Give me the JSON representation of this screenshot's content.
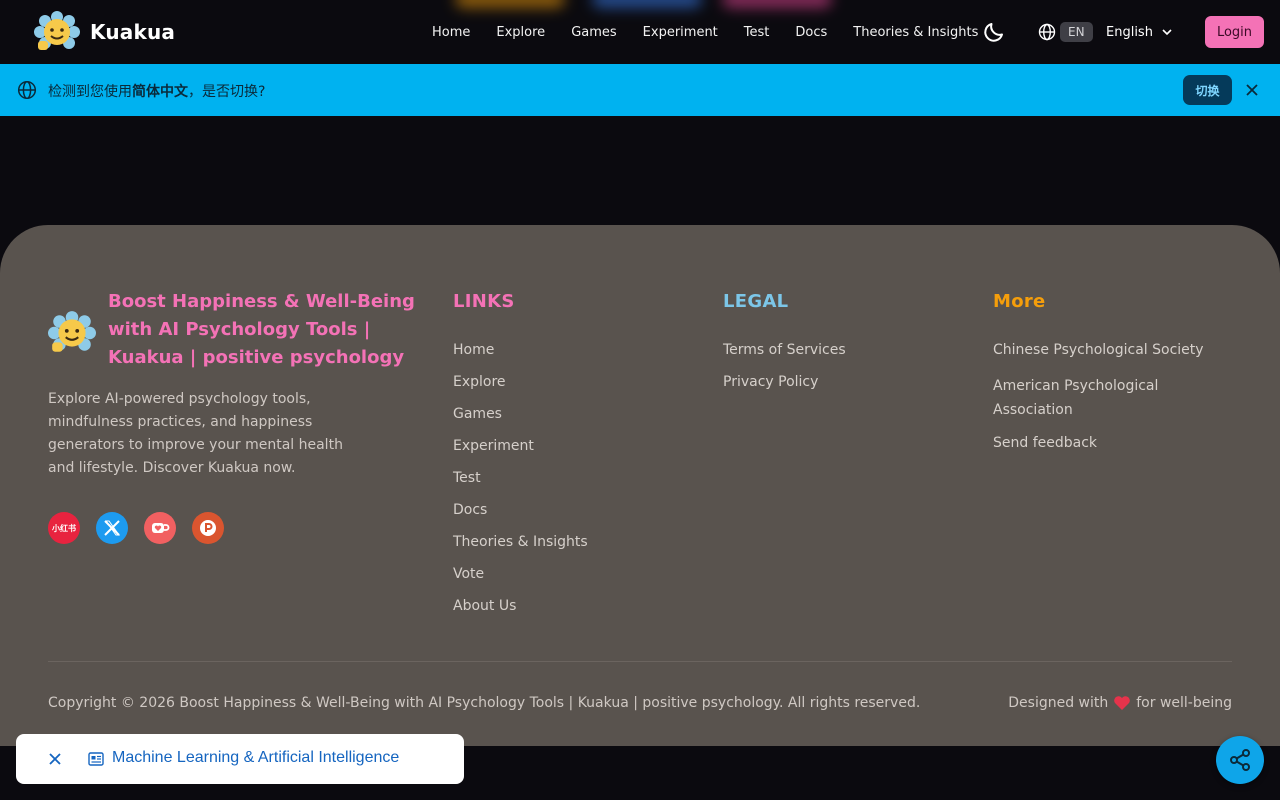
{
  "header": {
    "brand": "Kuakua",
    "nav": [
      "Home",
      "Explore",
      "Games",
      "Experiment",
      "Test",
      "Docs",
      "Theories & Insights"
    ],
    "lang_badge": "EN",
    "lang_select": "English",
    "login": "Login"
  },
  "banner": {
    "text_prefix": "检测到您使用",
    "text_lang": "简体中文",
    "text_suffix": "，是否切换?",
    "switch": "切换"
  },
  "footer": {
    "title": "Boost Happiness & Well-Being with AI Psychology Tools | Kuakua | positive psychology",
    "description": "Explore AI-powered psychology tools, mindfulness practices, and happiness generators to improve your mental health and lifestyle. Discover Kuakua now.",
    "social_red_label": "小红书",
    "links": {
      "heading": "LINKS",
      "items": [
        "Home",
        "Explore",
        "Games",
        "Experiment",
        "Test",
        "Docs",
        "Theories & Insights",
        "Vote",
        "About Us"
      ]
    },
    "legal": {
      "heading": "LEGAL",
      "items": [
        "Terms of Services",
        "Privacy Policy"
      ]
    },
    "more": {
      "heading": "More",
      "items": [
        "Chinese Psychological Society",
        "American Psychological Association",
        "Send feedback"
      ]
    },
    "copyright": "Copyright © 2026 Boost Happiness & Well-Being with AI Psychology Tools | Kuakua | positive psychology. All rights reserved.",
    "designed_prefix": "Designed with",
    "designed_suffix": "for well-being"
  },
  "toast": {
    "text": "Machine Learning & Artificial Intelligence"
  },
  "colors": {
    "accent_pink": "#f472b6",
    "banner_blue": "#00b2f0",
    "footer_bg": "#59534e",
    "legal_blue": "#7cc6e8",
    "more_orange": "#f59e0b"
  }
}
